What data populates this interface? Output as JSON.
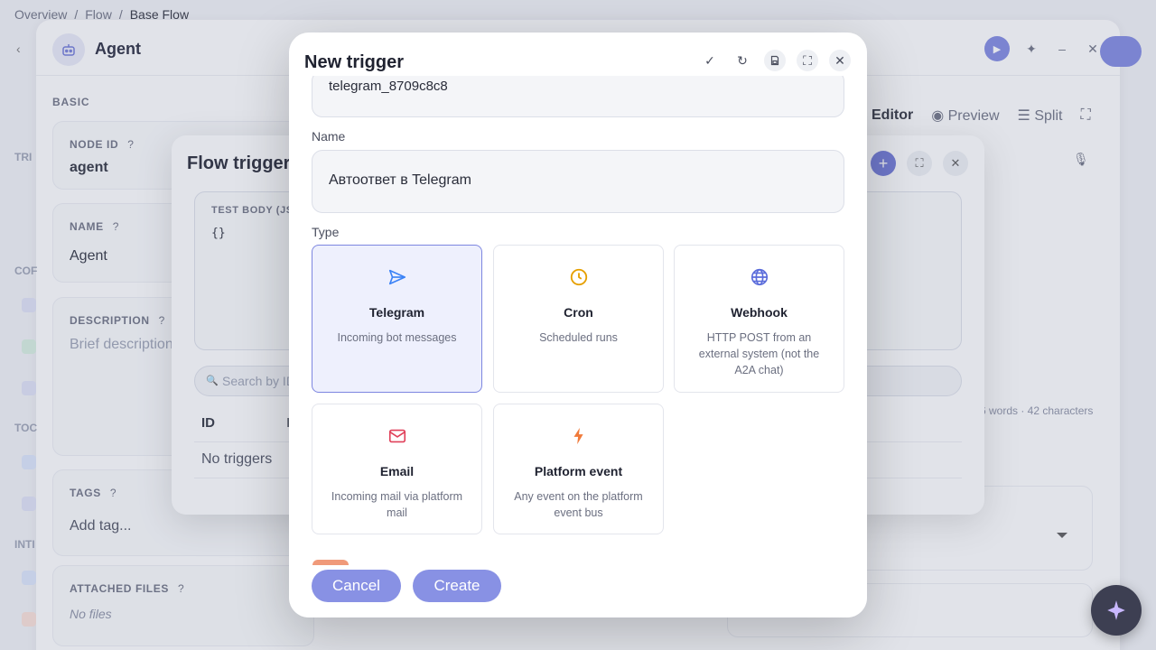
{
  "breadcrumb": [
    "Overview",
    "/",
    "Flow",
    "/",
    "Base Flow"
  ],
  "agent": {
    "title": "Agent",
    "basic_label": "BASIC",
    "node_id_label": "NODE ID",
    "node_id_value": "agent",
    "name_label": "NAME",
    "name_value": "Agent",
    "description_label": "DESCRIPTION",
    "description_placeholder": "Brief description",
    "tags_label": "TAGS",
    "tags_placeholder": "Add tag...",
    "files_label": "ATTACHED FILES",
    "files_value": "No files",
    "help_glyph": "?",
    "rail": [
      "TRI",
      "COF",
      "TOC",
      "INTI"
    ]
  },
  "editor": {
    "tabs": [
      "Editor",
      "Preview",
      "Split"
    ],
    "word_count": "6 words · 42 characters"
  },
  "flow_triggers": {
    "title": "Flow triggers",
    "test_body_label": "TEST BODY (JS",
    "test_body_value": "{}",
    "search_placeholder": "Search by ID",
    "col_id": "ID",
    "col_n": "I",
    "empty": "No triggers"
  },
  "new_trigger": {
    "title": "New trigger",
    "id_value": "telegram_8709c8c8",
    "name_label": "Name",
    "name_value": "Автоответ в Telegram",
    "type_label": "Type",
    "types": [
      {
        "title": "Telegram",
        "desc": "Incoming bot messages",
        "icon": "send-icon",
        "selected": true
      },
      {
        "title": "Cron",
        "desc": "Scheduled runs",
        "icon": "clock-icon",
        "selected": false
      },
      {
        "title": "Webhook",
        "desc": "HTTP POST from an external system (not the A2A chat)",
        "icon": "globe-icon",
        "selected": false
      },
      {
        "title": "Email",
        "desc": "Incoming mail via platform mail",
        "icon": "mail-icon",
        "selected": false
      },
      {
        "title": "Platform event",
        "desc": "Any event on the platform event bus",
        "icon": "bolt-icon",
        "selected": false
      }
    ],
    "cancel_label": "Cancel",
    "create_label": "Create"
  },
  "colors": {
    "accent": "#7d86e0",
    "telegram": "#3b82f6",
    "cron": "#e6a000",
    "webhook": "#5b6cdb",
    "email": "#e0415a",
    "event": "#f07a3a"
  }
}
